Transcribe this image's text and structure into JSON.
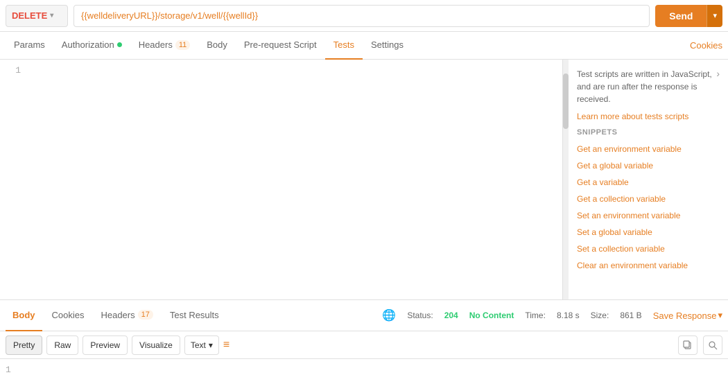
{
  "method": {
    "value": "DELETE",
    "chevron": "▾"
  },
  "url": "{{welldeliveryURL}}/storage/v1/well/{{wellId}}",
  "send_button": "Send",
  "cookies_button": "Cookies",
  "tabs": [
    {
      "id": "params",
      "label": "Params",
      "active": false
    },
    {
      "id": "authorization",
      "label": "Authorization",
      "dot": true,
      "active": false
    },
    {
      "id": "headers",
      "label": "Headers",
      "badge": "11",
      "active": false
    },
    {
      "id": "body",
      "label": "Body",
      "active": false
    },
    {
      "id": "prerequest",
      "label": "Pre-request Script",
      "active": false
    },
    {
      "id": "tests",
      "label": "Tests",
      "active": true
    },
    {
      "id": "settings",
      "label": "Settings",
      "active": false
    }
  ],
  "editor": {
    "line1": "1"
  },
  "sidebar": {
    "description": "Test scripts are written in JavaScript, and are run after the response is received.",
    "learn_more": "Learn more about tests scripts",
    "snippets_label": "SNIPPETS",
    "snippets": [
      "Get an environment variable",
      "Get a global variable",
      "Get a variable",
      "Get a collection variable",
      "Set an environment variable",
      "Set a global variable",
      "Set a collection variable",
      "Clear an environment variable"
    ]
  },
  "response_tabs": [
    {
      "id": "body",
      "label": "Body",
      "active": true
    },
    {
      "id": "cookies",
      "label": "Cookies",
      "active": false
    },
    {
      "id": "headers",
      "label": "Headers",
      "badge": "17",
      "active": false
    },
    {
      "id": "test_results",
      "label": "Test Results",
      "active": false
    }
  ],
  "status": {
    "status_label": "Status:",
    "code": "204",
    "text": "No Content",
    "time_label": "Time:",
    "time_value": "8.18 s",
    "size_label": "Size:",
    "size_value": "861 B"
  },
  "save_response": "Save Response",
  "response_toolbar": {
    "pretty": "Pretty",
    "raw": "Raw",
    "preview": "Preview",
    "visualize": "Visualize",
    "text": "Text",
    "chevron": "▾"
  },
  "response_body": {
    "line1": "1"
  }
}
